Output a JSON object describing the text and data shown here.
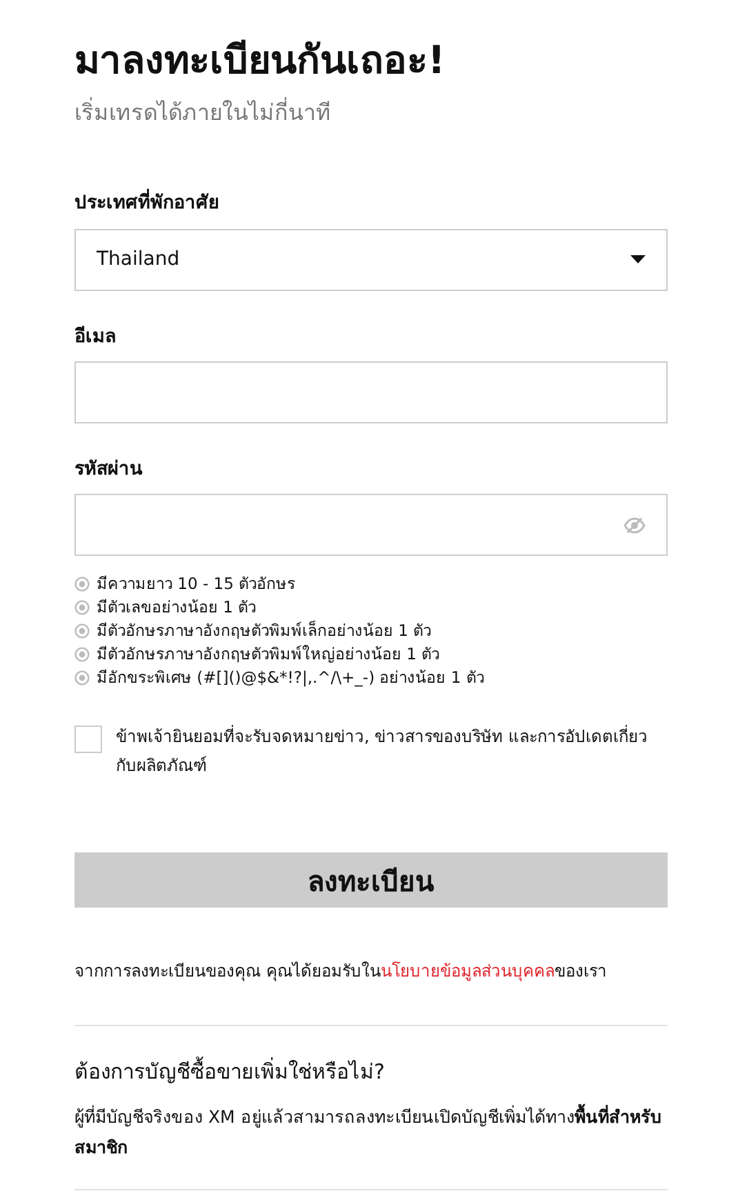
{
  "title": "มาลงทะเบียนกันเถอะ!",
  "subtitle": "เริ่มเทรดได้ภายในไม่กี่นาที",
  "country": {
    "label": "ประเทศที่พักอาศัย",
    "value": "Thailand"
  },
  "email": {
    "label": "อีเมล"
  },
  "password": {
    "label": "รหัสผ่าน"
  },
  "rules": [
    {
      "text": "มีความยาว 10 - 15 ตัวอักษร",
      "met": false
    },
    {
      "text": "มีตัวเลขอย่างน้อย 1 ตัว",
      "met": false
    },
    {
      "text": "มีตัวอักษรภาษาอังกฤษตัวพิมพ์เล็กอย่างน้อย 1 ตัว",
      "met": false
    },
    {
      "text": "มีตัวอักษรภาษาอังกฤษตัวพิมพ์ใหญ่อย่างน้อย 1 ตัว",
      "met": false
    },
    {
      "text": "มีอักขระพิเศษ (#[]()@$&*!?|,.^/\\+_-) อย่างน้อย 1 ตัว",
      "met": false
    }
  ],
  "consent": {
    "text": "ข้าพเจ้ายินยอมที่จะรับจดหมายข่าว, ข่าวสารของบริษัท และการอัปเดตเกี่ยวกับผลิตภัณฑ์",
    "checked": false
  },
  "submit": {
    "label": "ลงทะเบียน",
    "disabled": true
  },
  "policy": {
    "before": "จากการลงทะเบียนของคุณ คุณได้ยอมรับใน",
    "link": "นโยบายข้อมูลส่วนบุคคล",
    "after": "ของเรา"
  },
  "more": {
    "question": "ต้องการบัญชีซื้อขายเพิ่มใช่หรือไม่?",
    "text": "ผู้ที่มีบัญชีจริงของ XM อยู่แล้วสามารถลงทะเบียนเปิดบัญชีเพิ่มได้ทาง**พื้นที่สำหรับสมาชิก**"
  }
}
